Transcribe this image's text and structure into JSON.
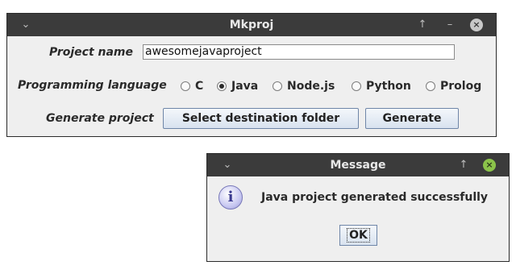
{
  "main_window": {
    "title": "Mkproj",
    "minimize_glyph": "↑",
    "maximize_glyph": "–",
    "close_glyph": "×",
    "project_name_label": "Project name",
    "project_name_value": "awesomejavaproject",
    "language_label": "Programming language",
    "languages": [
      {
        "label": "C",
        "selected": false
      },
      {
        "label": "Java",
        "selected": true
      },
      {
        "label": "Node.js",
        "selected": false
      },
      {
        "label": "Python",
        "selected": false
      },
      {
        "label": "Prolog",
        "selected": false
      }
    ],
    "generate_label": "Generate project",
    "select_folder_button": "Select destination folder",
    "generate_button": "Generate"
  },
  "message_window": {
    "title": "Message",
    "minimize_glyph": "↑",
    "close_glyph": "×",
    "icon_glyph": "i",
    "message": "Java project generated successfully",
    "ok_button": "OK"
  },
  "colors": {
    "titlebar": "#3b3b3b",
    "close_main": "#c8c8c8",
    "close_message": "#8bc34a"
  }
}
